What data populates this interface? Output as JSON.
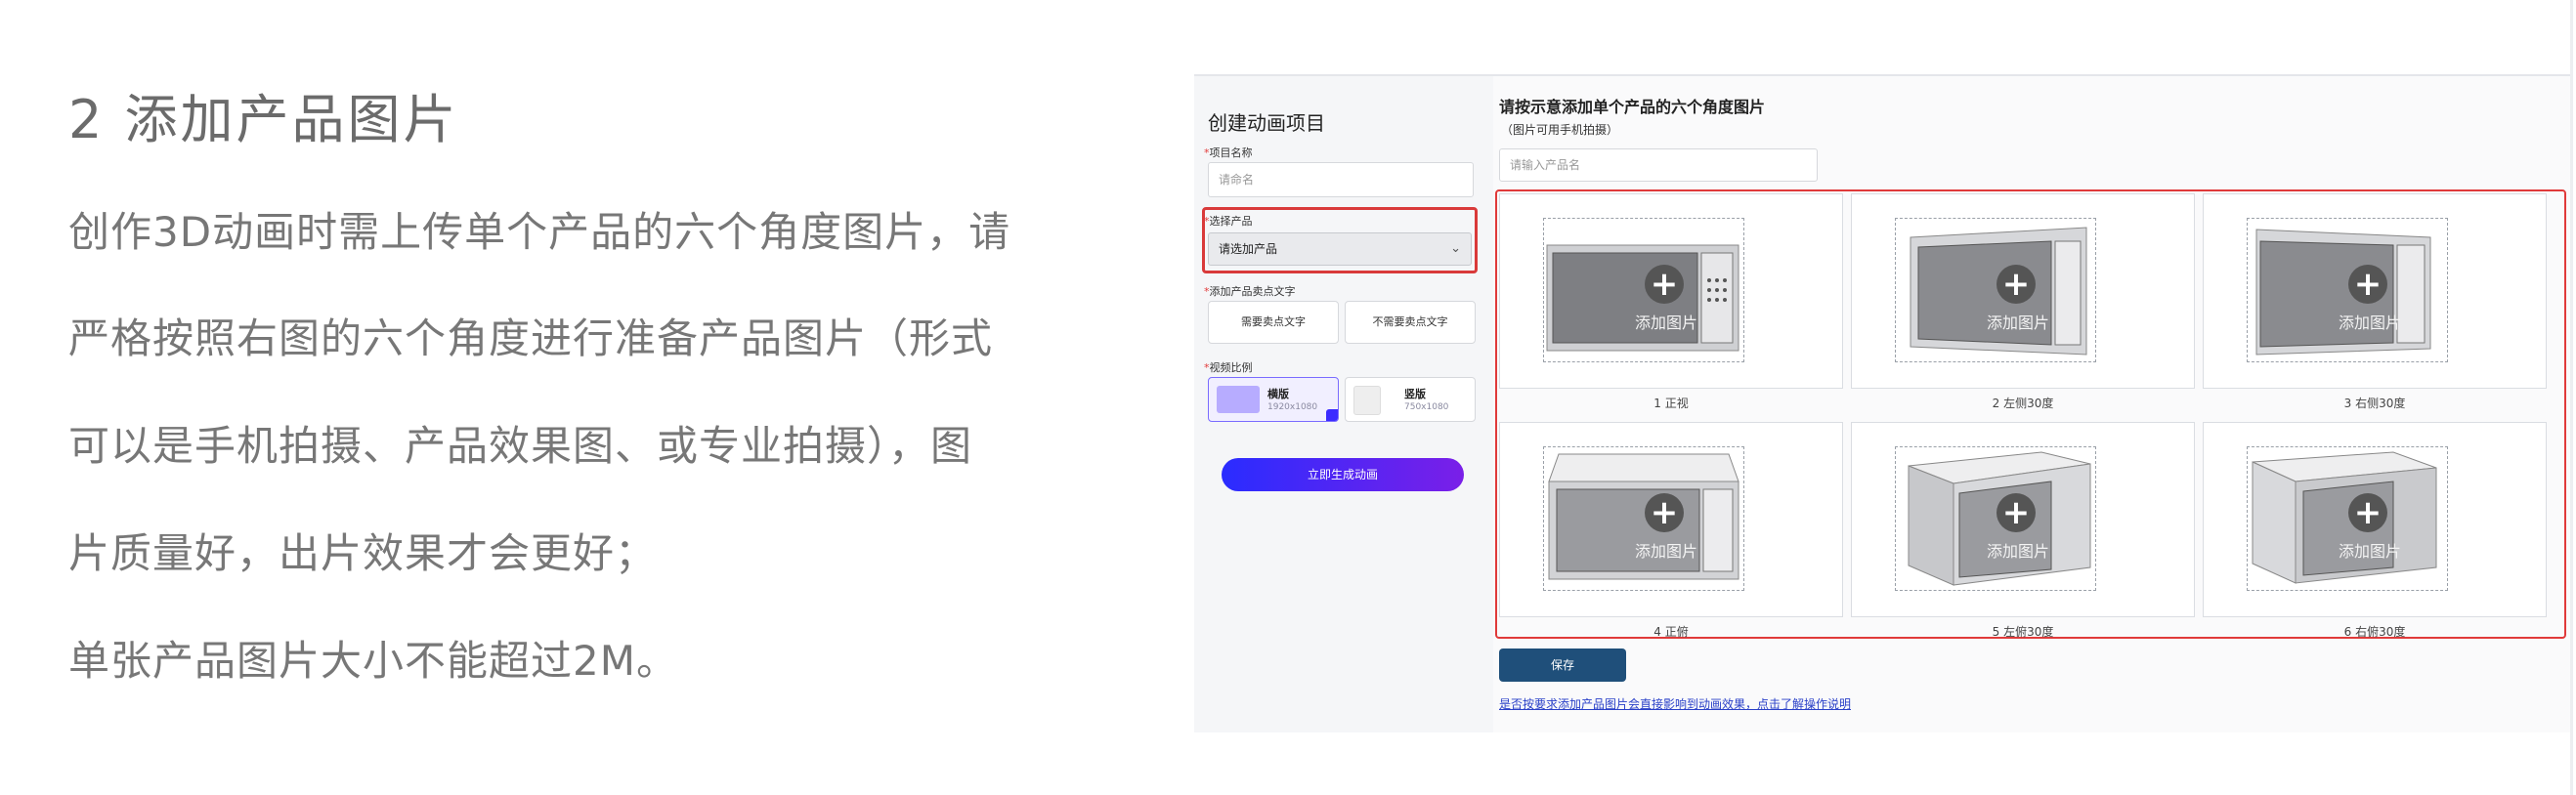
{
  "left": {
    "heading": "2 添加产品图片",
    "lines": [
      "创作3D动画时需上传单个产品的六个角度图片，请",
      "严格按照右图的六个角度进行准备产品图片（形式",
      "可以是手机拍摄、产品效果图、或专业拍摄），图",
      "片质量好，出片效果才会更好；",
      "单张产品图片大小不能超过2M。"
    ]
  },
  "form": {
    "title": "创建动画项目",
    "required_mark": "*",
    "project_name_label": "项目名称",
    "project_name_placeholder": "请命名",
    "product_label": "选择产品",
    "product_select": "请选加产品",
    "selling_label": "添加产品卖点文字",
    "need_selling": "需要卖点文字",
    "no_selling": "不需要卖点文字",
    "ratio_label": "视频比例",
    "landscape_title": "横版",
    "landscape_size": "1920x1080",
    "portrait_title": "竖版",
    "portrait_size": "750x1080",
    "generate_button": "立即生成动画"
  },
  "area": {
    "title": "请按示意添加单个产品的六个角度图片",
    "subtitle": "（图片可用手机拍摄）",
    "name_placeholder": "请输入产品名",
    "add_label": "添加图片",
    "captions": [
      "1 正视",
      "2 左侧30度",
      "3 右侧30度",
      "4 正俯",
      "5 左俯30度",
      "6 右俯30度"
    ],
    "save_button": "保存",
    "hint": "是否按要求添加产品图片会直接影响到动画效果，点击了解操作说明"
  },
  "colors": {
    "highlight": "#e03a3a",
    "generate_gradient_start": "#2a2cff",
    "generate_gradient_end": "#7a1fe8",
    "save_button": "#1f4f7a",
    "hint_link": "#2a40c8"
  }
}
